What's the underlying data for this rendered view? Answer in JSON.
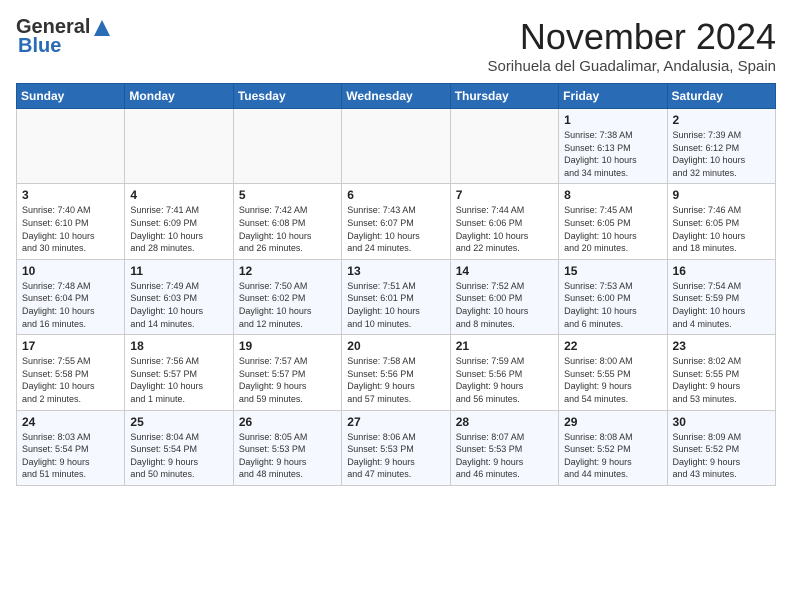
{
  "header": {
    "logo_line1": "General",
    "logo_line2": "Blue",
    "month": "November 2024",
    "location": "Sorihuela del Guadalimar, Andalusia, Spain"
  },
  "days_of_week": [
    "Sunday",
    "Monday",
    "Tuesday",
    "Wednesday",
    "Thursday",
    "Friday",
    "Saturday"
  ],
  "weeks": [
    [
      {
        "day": "",
        "info": ""
      },
      {
        "day": "",
        "info": ""
      },
      {
        "day": "",
        "info": ""
      },
      {
        "day": "",
        "info": ""
      },
      {
        "day": "",
        "info": ""
      },
      {
        "day": "1",
        "info": "Sunrise: 7:38 AM\nSunset: 6:13 PM\nDaylight: 10 hours\nand 34 minutes."
      },
      {
        "day": "2",
        "info": "Sunrise: 7:39 AM\nSunset: 6:12 PM\nDaylight: 10 hours\nand 32 minutes."
      }
    ],
    [
      {
        "day": "3",
        "info": "Sunrise: 7:40 AM\nSunset: 6:10 PM\nDaylight: 10 hours\nand 30 minutes."
      },
      {
        "day": "4",
        "info": "Sunrise: 7:41 AM\nSunset: 6:09 PM\nDaylight: 10 hours\nand 28 minutes."
      },
      {
        "day": "5",
        "info": "Sunrise: 7:42 AM\nSunset: 6:08 PM\nDaylight: 10 hours\nand 26 minutes."
      },
      {
        "day": "6",
        "info": "Sunrise: 7:43 AM\nSunset: 6:07 PM\nDaylight: 10 hours\nand 24 minutes."
      },
      {
        "day": "7",
        "info": "Sunrise: 7:44 AM\nSunset: 6:06 PM\nDaylight: 10 hours\nand 22 minutes."
      },
      {
        "day": "8",
        "info": "Sunrise: 7:45 AM\nSunset: 6:05 PM\nDaylight: 10 hours\nand 20 minutes."
      },
      {
        "day": "9",
        "info": "Sunrise: 7:46 AM\nSunset: 6:05 PM\nDaylight: 10 hours\nand 18 minutes."
      }
    ],
    [
      {
        "day": "10",
        "info": "Sunrise: 7:48 AM\nSunset: 6:04 PM\nDaylight: 10 hours\nand 16 minutes."
      },
      {
        "day": "11",
        "info": "Sunrise: 7:49 AM\nSunset: 6:03 PM\nDaylight: 10 hours\nand 14 minutes."
      },
      {
        "day": "12",
        "info": "Sunrise: 7:50 AM\nSunset: 6:02 PM\nDaylight: 10 hours\nand 12 minutes."
      },
      {
        "day": "13",
        "info": "Sunrise: 7:51 AM\nSunset: 6:01 PM\nDaylight: 10 hours\nand 10 minutes."
      },
      {
        "day": "14",
        "info": "Sunrise: 7:52 AM\nSunset: 6:00 PM\nDaylight: 10 hours\nand 8 minutes."
      },
      {
        "day": "15",
        "info": "Sunrise: 7:53 AM\nSunset: 6:00 PM\nDaylight: 10 hours\nand 6 minutes."
      },
      {
        "day": "16",
        "info": "Sunrise: 7:54 AM\nSunset: 5:59 PM\nDaylight: 10 hours\nand 4 minutes."
      }
    ],
    [
      {
        "day": "17",
        "info": "Sunrise: 7:55 AM\nSunset: 5:58 PM\nDaylight: 10 hours\nand 2 minutes."
      },
      {
        "day": "18",
        "info": "Sunrise: 7:56 AM\nSunset: 5:57 PM\nDaylight: 10 hours\nand 1 minute."
      },
      {
        "day": "19",
        "info": "Sunrise: 7:57 AM\nSunset: 5:57 PM\nDaylight: 9 hours\nand 59 minutes."
      },
      {
        "day": "20",
        "info": "Sunrise: 7:58 AM\nSunset: 5:56 PM\nDaylight: 9 hours\nand 57 minutes."
      },
      {
        "day": "21",
        "info": "Sunrise: 7:59 AM\nSunset: 5:56 PM\nDaylight: 9 hours\nand 56 minutes."
      },
      {
        "day": "22",
        "info": "Sunrise: 8:00 AM\nSunset: 5:55 PM\nDaylight: 9 hours\nand 54 minutes."
      },
      {
        "day": "23",
        "info": "Sunrise: 8:02 AM\nSunset: 5:55 PM\nDaylight: 9 hours\nand 53 minutes."
      }
    ],
    [
      {
        "day": "24",
        "info": "Sunrise: 8:03 AM\nSunset: 5:54 PM\nDaylight: 9 hours\nand 51 minutes."
      },
      {
        "day": "25",
        "info": "Sunrise: 8:04 AM\nSunset: 5:54 PM\nDaylight: 9 hours\nand 50 minutes."
      },
      {
        "day": "26",
        "info": "Sunrise: 8:05 AM\nSunset: 5:53 PM\nDaylight: 9 hours\nand 48 minutes."
      },
      {
        "day": "27",
        "info": "Sunrise: 8:06 AM\nSunset: 5:53 PM\nDaylight: 9 hours\nand 47 minutes."
      },
      {
        "day": "28",
        "info": "Sunrise: 8:07 AM\nSunset: 5:53 PM\nDaylight: 9 hours\nand 46 minutes."
      },
      {
        "day": "29",
        "info": "Sunrise: 8:08 AM\nSunset: 5:52 PM\nDaylight: 9 hours\nand 44 minutes."
      },
      {
        "day": "30",
        "info": "Sunrise: 8:09 AM\nSunset: 5:52 PM\nDaylight: 9 hours\nand 43 minutes."
      }
    ]
  ]
}
